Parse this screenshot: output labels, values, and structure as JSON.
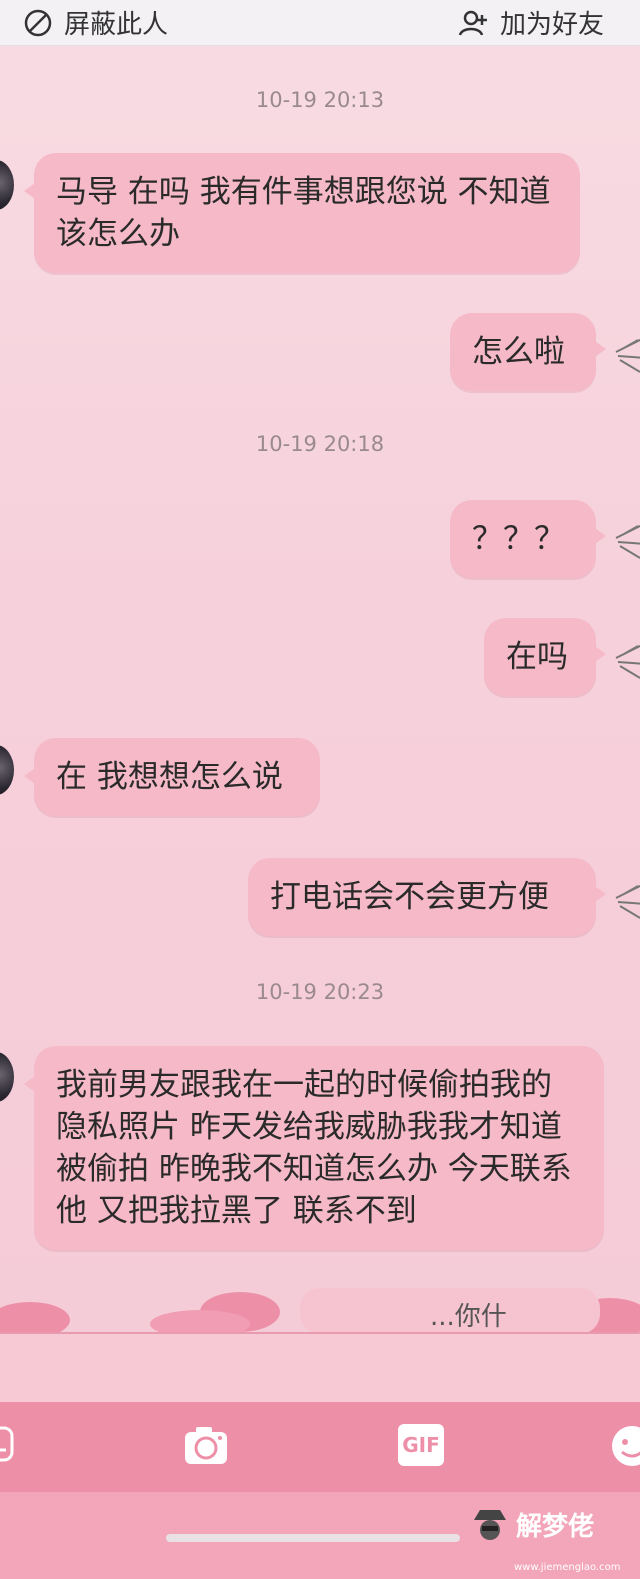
{
  "header": {
    "block_label": "屏蔽此人",
    "add_friend_label": "加为好友"
  },
  "messages": [
    {
      "type": "timestamp",
      "text": "10-19 20:13"
    },
    {
      "type": "in",
      "text": "马导 在吗 我有件事想跟您说 不知道该怎么办"
    },
    {
      "type": "out",
      "text": "怎么啦"
    },
    {
      "type": "timestamp",
      "text": "10-19 20:18"
    },
    {
      "type": "out",
      "text": "？？？"
    },
    {
      "type": "out",
      "text": "在吗"
    },
    {
      "type": "in",
      "text": "在 我想想怎么说"
    },
    {
      "type": "out",
      "text": "打电话会不会更方便"
    },
    {
      "type": "timestamp",
      "text": "10-19 20:23"
    },
    {
      "type": "in",
      "text": "我前男友跟我在一起的时候偷拍我的隐私照片 昨天发给我威胁我我才知道被偷拍 昨晚我不知道怎么办 今天联系他 又把我拉黑了 联系不到"
    }
  ],
  "partial_message": "...你什",
  "toolbar": {
    "gif_label": "GIF",
    "icons": [
      "voice-icon",
      "camera-icon",
      "gif-icon",
      "emoji-icon"
    ]
  },
  "watermark": {
    "text": "解梦佬",
    "url": "www.jiemenglao.com"
  },
  "colors": {
    "bubble": "#f5b9c8",
    "background": "#f8dce3",
    "toolbar": "#ee8fa8"
  }
}
